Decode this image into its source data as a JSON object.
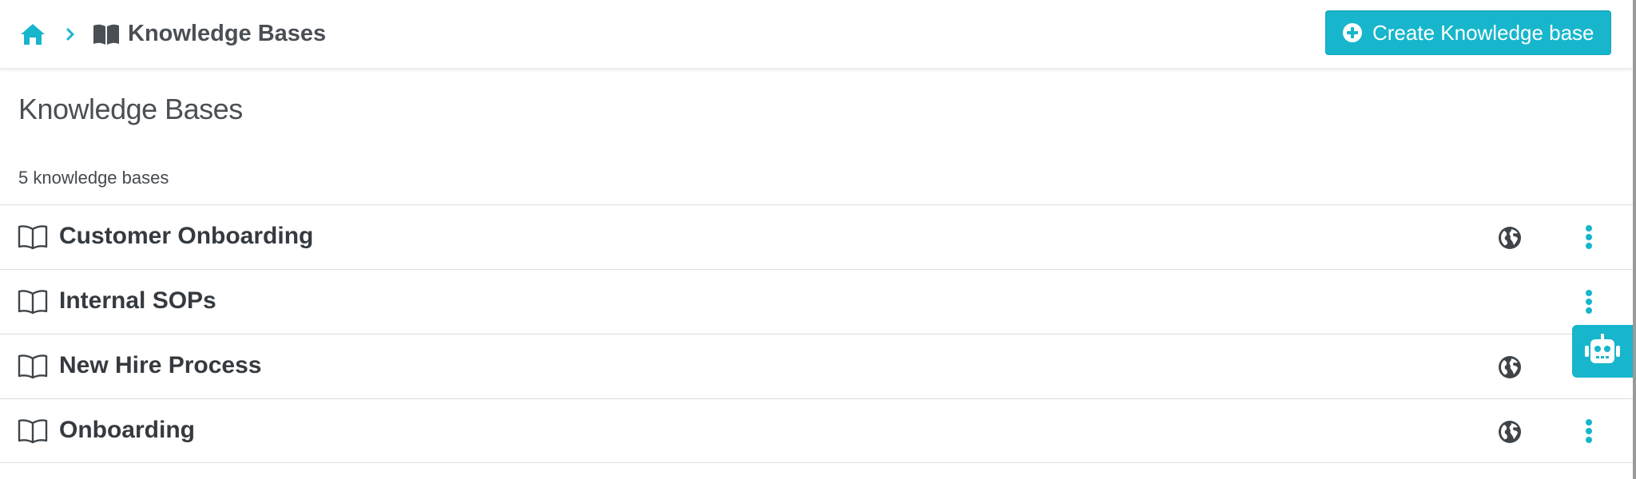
{
  "breadcrumb": {
    "home_icon": "home-icon",
    "separator_icon": "chevron-right-icon",
    "current_icon": "book-open-icon",
    "current_label": "Knowledge Bases"
  },
  "header": {
    "create_button_label": "Create Knowledge base",
    "create_button_icon": "plus-circle-icon"
  },
  "main": {
    "title": "Knowledge Bases",
    "count_label": "5 knowledge bases",
    "items": [
      {
        "name": "Customer Onboarding",
        "public": true,
        "icon": "book-outline-icon"
      },
      {
        "name": "Internal SOPs",
        "public": false,
        "icon": "book-outline-icon"
      },
      {
        "name": "New Hire Process",
        "public": true,
        "icon": "book-outline-icon"
      },
      {
        "name": "Onboarding",
        "public": true,
        "icon": "book-outline-icon"
      }
    ]
  },
  "assistant": {
    "icon": "robot-icon"
  },
  "colors": {
    "accent": "#17b6cc",
    "text_dark": "#353a40",
    "text_muted": "#4a4f55",
    "globe": "#3f4449",
    "border": "#dcdcdc"
  }
}
